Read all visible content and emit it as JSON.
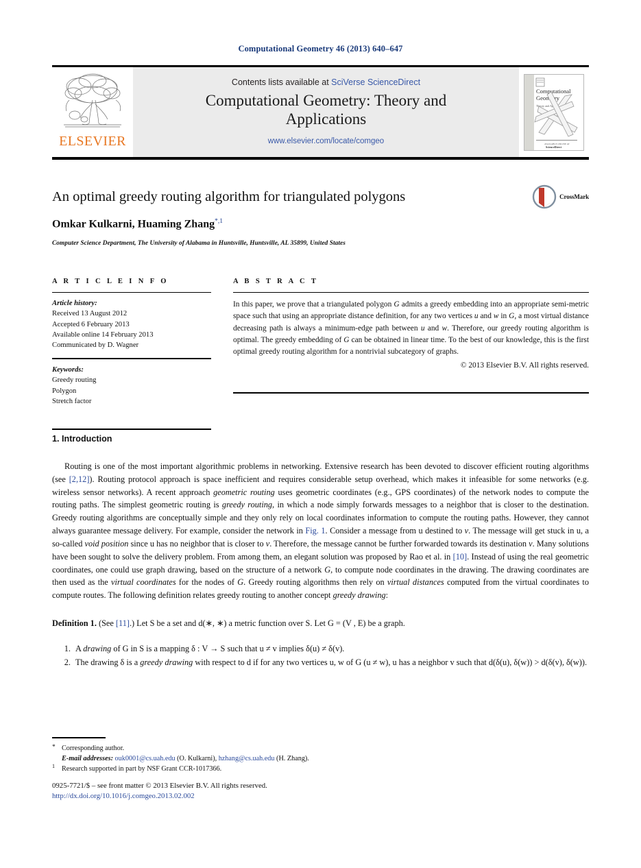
{
  "running_head": "Computational Geometry 46 (2013) 640–647",
  "masthead": {
    "contents_prefix": "Contents lists available at ",
    "sciencedirect_link": "SciVerse ScienceDirect",
    "journal_title": "Computational Geometry: Theory and Applications",
    "journal_url": "www.elsevier.com/locate/comgeo",
    "publisher_wordmark": "ELSEVIER",
    "cover": {
      "title_line1": "Computational",
      "title_line2": "Geometry",
      "subtitle": "Theory and Applications"
    }
  },
  "article": {
    "title": "An optimal greedy routing algorithm for triangulated polygons",
    "crossmark_label": "CrossMark",
    "authors": "Omkar Kulkarni, Huaming Zhang",
    "author_marks": "*,1",
    "affiliation": "Computer Science Department, The University of Alabama in Huntsville, Huntsville, AL 35899, United States"
  },
  "article_info": {
    "heading": "A R T I C L E   I N F O",
    "history_label": "Article history:",
    "history": [
      "Received 13 August 2012",
      "Accepted 6 February 2013",
      "Available online 14 February 2013",
      "Communicated by D. Wagner"
    ],
    "keywords_label": "Keywords:",
    "keywords": [
      "Greedy routing",
      "Polygon",
      "Stretch factor"
    ]
  },
  "abstract": {
    "heading": "A B S T R A C T",
    "text_parts": [
      "In this paper, we prove that a triangulated polygon ",
      "G",
      " admits a greedy embedding into an appropriate semi-metric space such that using an appropriate distance definition, for any two vertices ",
      "u",
      " and ",
      "w",
      " in ",
      "G",
      ", a most virtual distance decreasing path is always a minimum-edge path between ",
      "u",
      " and ",
      "w",
      ". Therefore, our greedy routing algorithm is optimal. The greedy embedding of ",
      "G",
      " can be obtained in linear time. To the best of our knowledge, this is the first optimal greedy routing algorithm for a nontrivial subcategory of graphs."
    ],
    "copyright": "© 2013 Elsevier B.V. All rights reserved."
  },
  "section": {
    "heading": "1. Introduction",
    "paragraph1": {
      "s1": "Routing is one of the most important algorithmic problems in networking. Extensive research has been devoted to discover efficient routing algorithms (see ",
      "ref1": "[2,12]",
      "s2": "). Routing protocol approach is space inefficient and requires considerable setup overhead, which makes it infeasible for some networks (e.g. wireless sensor networks). A recent approach ",
      "em1": "geometric routing",
      "s3": " uses geometric coordinates (e.g., GPS coordinates) of the network nodes to compute the routing paths. The simplest geometric routing is ",
      "em2": "greedy routing",
      "s4": ", in which a node simply forwards messages to a neighbor that is closer to the destination. Greedy routing algorithms are conceptually simple and they only rely on local coordinates information to compute the routing paths. However, they cannot always guarantee message delivery. For example, consider the network in ",
      "ref2": "Fig. 1",
      "s5": ". Consider a message from u destined to ",
      "mi1": "v",
      "s6": ". The message will get stuck in u, a so-called ",
      "em3": "void position",
      "s7": " since u has no neighbor that is closer to ",
      "mi2": "v",
      "s8": ". Therefore, the message cannot be further forwarded towards its destination ",
      "mi3": "v",
      "s9": ". Many solutions have been sought to solve the delivery problem. From among them, an elegant solution was proposed by Rao et al. in ",
      "ref3": "[10]",
      "s10": ". Instead of using the real geometric coordinates, one could use graph drawing, based on the structure of a network ",
      "mi4": "G",
      "s11": ", to compute node coordinates in the drawing. The drawing coordinates are then used as the ",
      "em4": "virtual coordinates",
      "s12": " for the nodes of ",
      "mi5": "G",
      "s13": ". Greedy routing algorithms then rely on ",
      "em5": "virtual distances",
      "s14": " computed from the virtual coordinates to compute routes. The following definition relates greedy routing to another concept ",
      "em6": "greedy drawing",
      "s15": ":"
    },
    "definition": {
      "label": "Definition 1.",
      "s1": " (See ",
      "ref": "[11]",
      "s2": ".) Let S be a set and d(∗, ∗) a metric function over S. Let G = (V , E) be a graph.",
      "items": [
        {
          "s1": "A ",
          "em1": "drawing",
          "s2": " of G in S is a mapping δ : V → S such that u ≠ v implies δ(u) ≠ δ(v)."
        },
        {
          "s1": "The drawing δ is a ",
          "em1": "greedy drawing",
          "s2": " with respect to d if for any two vertices u, w of G (u ≠ w), u has a neighbor v such that d(δ(u), δ(w)) > d(δ(v), δ(w))."
        }
      ]
    }
  },
  "footnotes": {
    "corresponding_mark": "*",
    "corresponding_text": "Corresponding author.",
    "email_label": "E-mail addresses:",
    "email1": "ouk0001@cs.uah.edu",
    "email1_owner": " (O. Kulkarni), ",
    "email2": "hzhang@cs.uah.edu",
    "email2_owner": " (H. Zhang).",
    "note_mark": "1",
    "note_text": "Research supported in part by NSF Grant CCR-1017366."
  },
  "bottom_matter": {
    "issn_line": "0925-7721/$ – see front matter © 2013 Elsevier B.V. All rights reserved.",
    "doi": "http://dx.doi.org/10.1016/j.comgeo.2013.02.002"
  },
  "colors": {
    "link_blue": "#2b4a9b",
    "elsevier_orange": "#E87722",
    "runhead_blue": "#1a3a7a",
    "masthead_grey": "#ebebeb"
  }
}
